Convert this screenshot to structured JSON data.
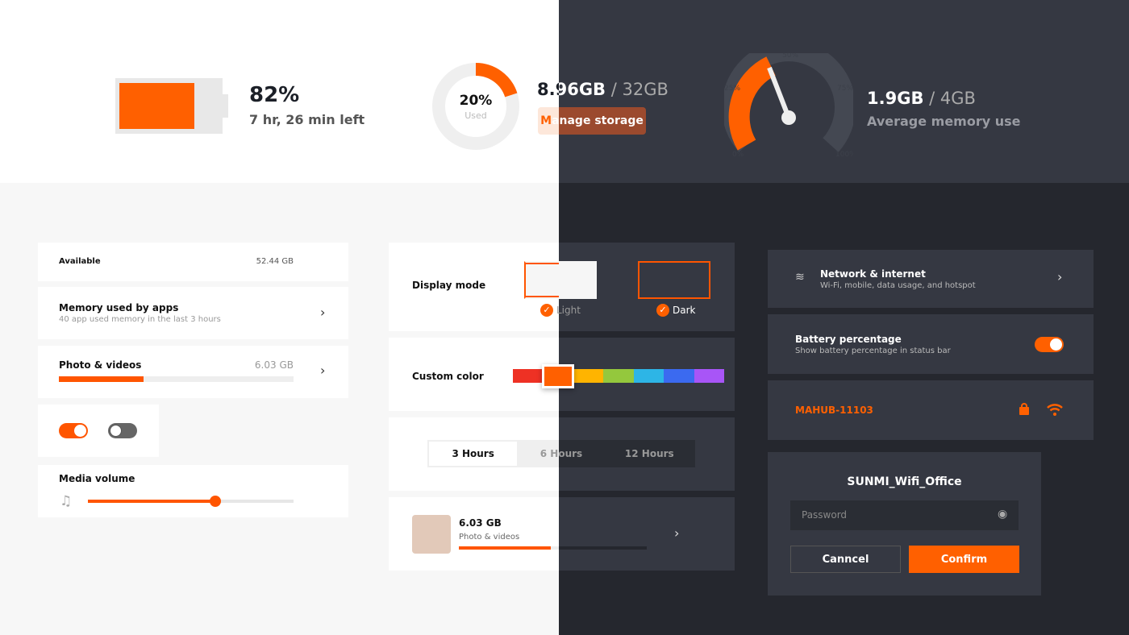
{
  "colors": {
    "accent": "#ff6000",
    "dark_bg": "#25272e",
    "dark_card": "#353842",
    "light_bg": "#f7f7f7"
  },
  "battery": {
    "percent": "82%",
    "level": 0.82,
    "time_left": "7 hr, 26 min left"
  },
  "storage": {
    "used_percent": "20%",
    "used_label": "Used",
    "used_fraction": 0.2,
    "used": "8.96GB",
    "total": "/ 32GB",
    "manage_label": "Manage storage"
  },
  "memory": {
    "used": "1.9GB",
    "total": "/ 4GB",
    "label": "Average memory use",
    "gauge_ticks": [
      "0%",
      "25%",
      "50%",
      "75%",
      "100%"
    ]
  },
  "left": {
    "available_label": "Available",
    "available_value": "52.44 GB",
    "apps_title": "Memory used by apps",
    "apps_sub": "40 app used memory in the last 3 hours",
    "photo_title": "Photo & videos",
    "photo_value": "6.03 GB",
    "photo_fraction": 0.36,
    "toggle_on": true,
    "toggle_off": false,
    "volume_title": "Media volume",
    "volume_level": 0.62
  },
  "middle": {
    "display_mode_label": "Display mode",
    "light_label": "Light",
    "dark_label": "Dark",
    "custom_color_label": "Custom color",
    "palette": [
      "#ee3124",
      "#ff6000",
      "#ffb400",
      "#94c83d",
      "#2db5e6",
      "#3b6af0",
      "#a855f7"
    ],
    "selected_color": "#ff6000",
    "segments": [
      "3 Hours",
      "6 Hours",
      "12 Hours"
    ],
    "selected_segment": "3 Hours",
    "photo_size": "6.03 GB",
    "photo_label": "Photo & videos",
    "photo_fraction": 0.49
  },
  "right": {
    "network_title": "Network & internet",
    "network_sub": "Wi-Fi, mobile, data usage, and hotspot",
    "battery_title": "Battery percentage",
    "battery_sub": "Show battery percentage in status bar",
    "battery_toggle": true,
    "wifi_name": "MAHUB-11103",
    "dialog_title": "SUNMI_Wifi_Office",
    "password_placeholder": "Password",
    "cancel_label": "Canncel",
    "confirm_label": "Confirm"
  }
}
